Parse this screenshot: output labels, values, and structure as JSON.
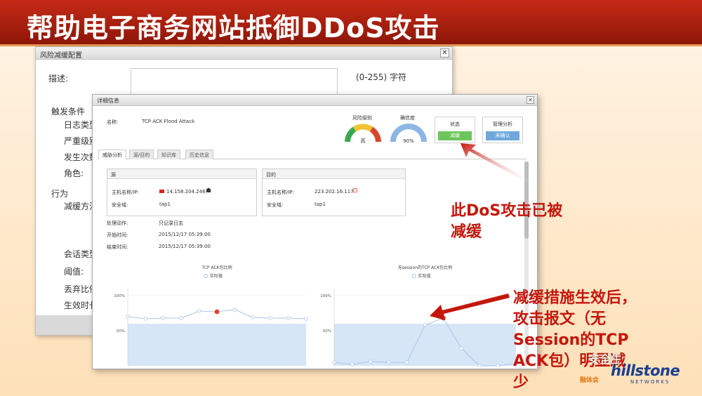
{
  "slide": {
    "title": "帮助电子商务网站抵御DDoS攻击"
  },
  "back_dialog": {
    "title": "风险减缓配置",
    "close": "✕",
    "description_label": "描述:",
    "description_hint": "(0-255) 字符",
    "section_trigger": "触发条件",
    "trigger_fields": [
      "日志类型",
      "严重级别",
      "发生次数",
      "角色:"
    ],
    "section_action": "行为",
    "action_fields": [
      "减缓方法"
    ],
    "session_fields": [
      "会话类型",
      "阈值:",
      "丢弃比例",
      "生效时长"
    ]
  },
  "front_dialog": {
    "title": "详细信息",
    "close": "✕",
    "name_label": "名称:",
    "name_value": "TCP ACK Flood Attack",
    "risk_label": "风险级别",
    "risk_value": "高",
    "confidence_label": "确信度",
    "confidence_value": "90%",
    "status": {
      "label": "状态",
      "value": "减缓",
      "color": "#6cc65b"
    },
    "manage": {
      "label": "管理分析",
      "value": "未确认"
    },
    "tabs": [
      "威胁分析",
      "源/目的",
      "知识库",
      "历史信息"
    ],
    "source": {
      "title": "源",
      "host_label": "主机名称/IP:",
      "host_value": "14.158.204.246",
      "zone_label": "安全域:",
      "zone_value": "tap1"
    },
    "dest": {
      "title": "目的",
      "host_label": "主机名称/IP:",
      "host_value": "223.202.16.117",
      "zone_label": "安全域:",
      "zone_value": "tap1"
    },
    "info": [
      {
        "label": "处理动作:",
        "value": "只记录日志"
      },
      {
        "label": "开始时间:",
        "value": "2015/12/17 05:39:00"
      },
      {
        "label": "结束时间:",
        "value": "2015/12/17 05:39:00"
      }
    ]
  },
  "chart_data": [
    {
      "type": "line",
      "title": "TCP ACK包比例",
      "series": [
        {
          "name": "实际值",
          "values": [
            70,
            67,
            68,
            68,
            78,
            77,
            80,
            69,
            68,
            68,
            67
          ]
        }
      ],
      "highlight_index": 5,
      "ylim": [
        0,
        100
      ],
      "y_ticks": [
        "100%",
        "50%"
      ],
      "baseline_band": 60
    },
    {
      "type": "line",
      "title": "无session的TCP ACK包比例",
      "series": [
        {
          "name": "实际值",
          "values": [
            5,
            2,
            6,
            5,
            5,
            58,
            68,
            25,
            0,
            0,
            3
          ]
        }
      ],
      "highlight_index": 6,
      "ylim": [
        0,
        100
      ],
      "y_ticks": [
        "100%",
        "50%"
      ],
      "baseline_band": 60
    }
  ],
  "annotations": {
    "mitigated": [
      "此DoS攻击已被",
      "减缓"
    ],
    "after": [
      "减缓措施生效后，",
      "攻击报文（无",
      "Session的TCP",
      "ACK包）明显减",
      "少"
    ]
  },
  "logo": {
    "text": "hillstone",
    "sub": "NETWORKS",
    "watermark": "安全生",
    "tag": "融体会"
  },
  "colors": {
    "accent": "#c4170c",
    "line": "#a9c6e8",
    "band": "#d7e6f6",
    "highlight": "#e0452f"
  }
}
